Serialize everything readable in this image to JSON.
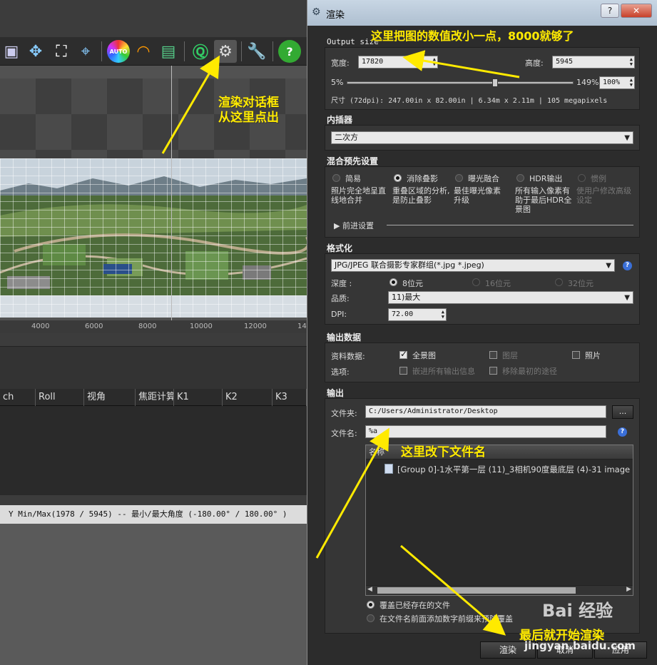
{
  "toolbar": {
    "icons": [
      "select-icon",
      "move-icon",
      "transform-icon",
      "crosshair-icon",
      "auto-color-icon",
      "exposure-icon",
      "image-icon",
      "quick-render-icon",
      "render-settings-gear-icon",
      "tools-wrench-icon",
      "help-icon"
    ],
    "auto_label": "AUTO"
  },
  "preview": {
    "ruler_ticks": [
      "4000",
      "6000",
      "8000",
      "10000",
      "12000",
      "14"
    ]
  },
  "table": {
    "columns": [
      "ch",
      "Roll",
      "视角",
      "焦距计算",
      "K1",
      "K2",
      "K3"
    ]
  },
  "statusbar": {
    "text": "Y Min/Max(1978 / 5945)   --   最小/最大角度 (-180.00°  / 180.00° )"
  },
  "dialog": {
    "title": "渲染",
    "help_btn": "?",
    "close_btn": "✕",
    "output_size": {
      "heading": "Output size",
      "width_label": "宽度:",
      "width_value": "17820",
      "height_label": "高度:",
      "height_value": "5945",
      "scale_min": "5%",
      "scale_max": "149%",
      "scale_pct": "100%",
      "scale_level": 0.66,
      "dims_text": "尺寸 (72dpi): 247.00in x 82.00in  |  6.34m x  2.11m  | 105 megapixels"
    },
    "interpolator": {
      "heading": "内插器",
      "value": "二次方"
    },
    "blend": {
      "heading": "混合预先设置",
      "options": [
        {
          "label": "简易",
          "desc": "照片完全地呈直线地合并",
          "state": "off"
        },
        {
          "label": "消除叠影",
          "desc": "重叠区域的分析,是防止叠影",
          "state": "on"
        },
        {
          "label": "曝光融合",
          "desc": "最佳曝光像素升级",
          "state": "off"
        },
        {
          "label": "HDR输出",
          "desc": "所有输入像素有助于最后HDR全景图",
          "state": "off"
        },
        {
          "label": "惯例",
          "desc": "使用户修改高级设定",
          "state": "disabled"
        }
      ],
      "advanced": "前进设置"
    },
    "format": {
      "heading": "格式化",
      "value": "JPG/JPEG 联合摄影专家群组(*.jpg *.jpeg)",
      "depth_label": "深度 :",
      "depth_options": [
        "8位元",
        "16位元",
        "32位元"
      ],
      "quality_label": "品质:",
      "quality_value": "11)最大",
      "dpi_label": "DPI:",
      "dpi_value": "72.00"
    },
    "output_data": {
      "heading": "输出数据",
      "data_label": "资料数据:",
      "options_label": "选项:",
      "panorama": "全景图",
      "layers": "图层",
      "photos": "照片",
      "embed": "嵌进所有输出信息",
      "remove": "移除最初的途径"
    },
    "output": {
      "heading": "输出",
      "folder_label": "文件夹:",
      "folder_value": "C:/Users/Administrator/Desktop",
      "browse": "...",
      "filename_label": "文件名:",
      "filename_value": "%a",
      "list_header": "名称",
      "files": [
        "[Group 0]-1水平第一层 (11)_3相机90度最底层 (4)-31 image"
      ],
      "overwrite": "覆盖已经存在的文件",
      "add_number": "在文件名前面添加数字前缀来预防覆盖"
    },
    "buttons": {
      "render": "渲染",
      "cancel": "取消",
      "apply": "应用"
    }
  },
  "annotations": {
    "top": "这里把图的数值改小一点，8000就够了",
    "left_line1": "渲染对话框",
    "left_line2": "从这里点出",
    "filename": "这里改下文件名",
    "render": "最后就开始渲染"
  },
  "watermark": {
    "site": "jingyan.baidu.com",
    "brand": "Bai 经验"
  },
  "colors": {
    "annotation": "#ffea00",
    "dialog_bg": "#2c2c2c",
    "title_bg": "#b8c8da"
  }
}
